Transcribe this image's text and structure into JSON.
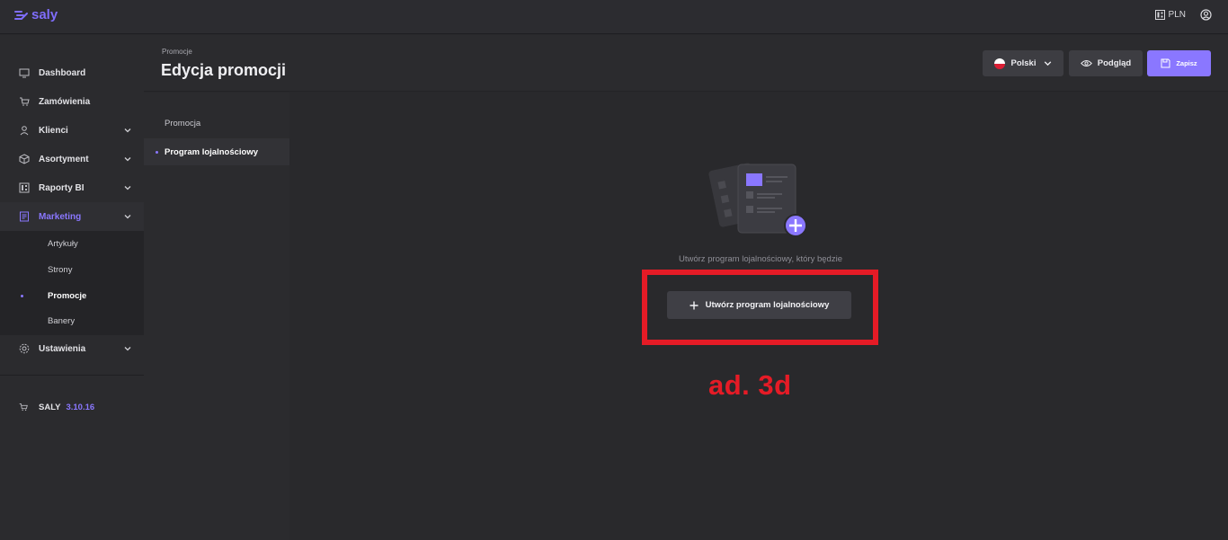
{
  "app": {
    "logo_text": "saly"
  },
  "topbar": {
    "currency_label": "PLN"
  },
  "sidebar": {
    "items": [
      {
        "label": "Dashboard"
      },
      {
        "label": "Zamówienia"
      },
      {
        "label": "Klienci"
      },
      {
        "label": "Asortyment"
      },
      {
        "label": "Raporty BI"
      },
      {
        "label": "Marketing"
      },
      {
        "label": "Ustawienia"
      }
    ],
    "marketing_sub": [
      {
        "label": "Artykuły"
      },
      {
        "label": "Strony"
      },
      {
        "label": "Promocje"
      },
      {
        "label": "Banery"
      }
    ],
    "footer": {
      "name": "SALY",
      "version": "3.10.16"
    }
  },
  "header": {
    "breadcrumb": "Promocje",
    "title": "Edycja promocji",
    "language_label": "Polski",
    "preview_label": "Podgląd",
    "save_label": "Zapisz"
  },
  "tabs": [
    {
      "label": "Promocja"
    },
    {
      "label": "Program lojalnościowy"
    }
  ],
  "empty_state": {
    "text": "Utwórz program lojalnościowy, który będzie",
    "button_label": "Utwórz program lojalnościowy"
  },
  "annotation": {
    "label": "ad. 3d",
    "color": "#e51b26"
  },
  "colors": {
    "accent": "#8a77ff",
    "background": "#29292c",
    "highlight": "#e51b26"
  }
}
